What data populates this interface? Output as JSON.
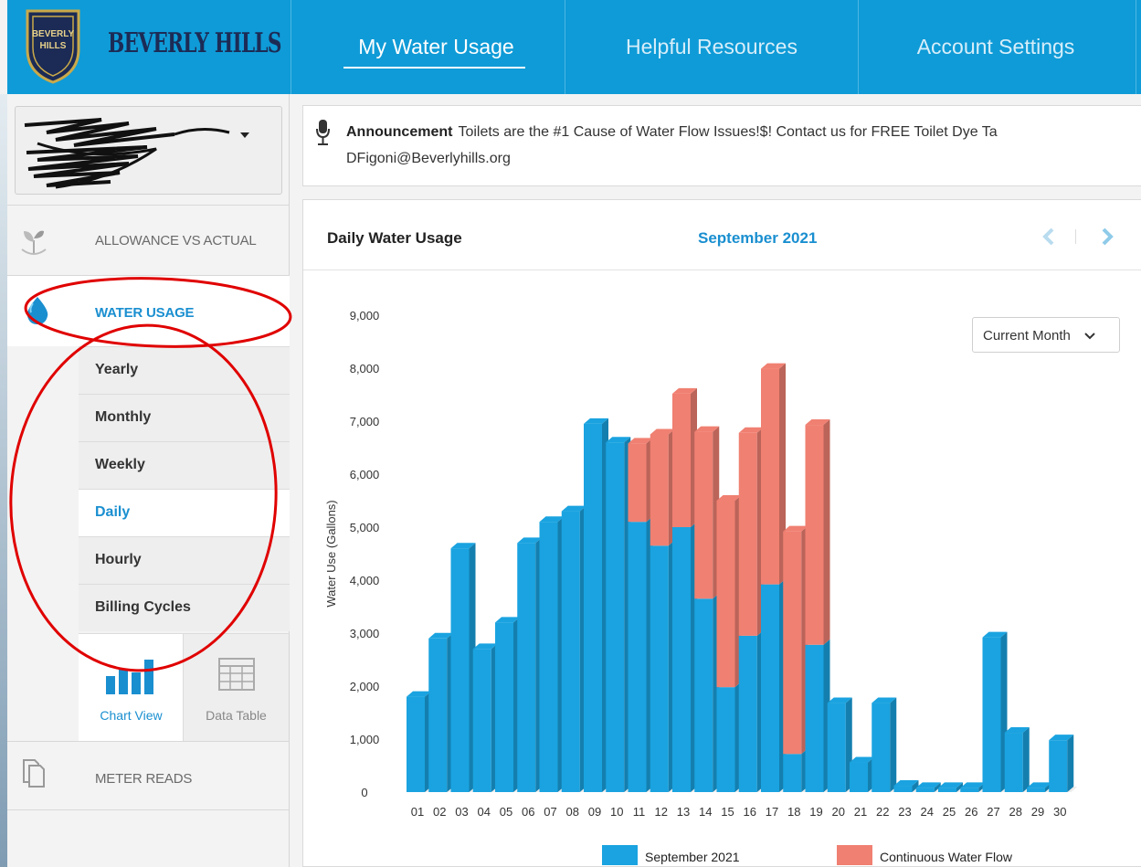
{
  "header": {
    "logo_text": "BEVERLY HILLS",
    "badge_text_line1": "BEVERLY",
    "badge_text_line2": "HILLS",
    "nav": [
      {
        "label": "My Water Usage",
        "active": true
      },
      {
        "label": "Helpful Resources",
        "active": false
      },
      {
        "label": "Account Settings",
        "active": false
      }
    ]
  },
  "sidebar": {
    "items": [
      {
        "label": "ALLOWANCE VS ACTUAL",
        "icon": "plant-icon"
      },
      {
        "label": "WATER USAGE",
        "icon": "water-drop-icon"
      },
      {
        "label": "METER READS",
        "icon": "documents-icon"
      }
    ],
    "subitems": [
      {
        "label": "Yearly",
        "active": false
      },
      {
        "label": "Monthly",
        "active": false
      },
      {
        "label": "Weekly",
        "active": false
      },
      {
        "label": "Daily",
        "active": true
      },
      {
        "label": "Hourly",
        "active": false
      },
      {
        "label": "Billing Cycles",
        "active": false
      }
    ],
    "views": [
      {
        "label": "Chart View",
        "active": true,
        "icon": "bar-chart-icon"
      },
      {
        "label": "Data Table",
        "active": false,
        "icon": "table-grid-icon"
      }
    ]
  },
  "announcement": {
    "title": "Announcement",
    "text": "Toilets are the #1 Cause of Water Flow Issues!$! Contact us for FREE Toilet Dye Ta",
    "email": "DFigoni@Beverlyhills.org"
  },
  "chart_panel": {
    "title": "Daily Water Usage",
    "month": "September 2021",
    "dropdown": "Current Month"
  },
  "colors": {
    "brand_blue": "#0f9bd7",
    "active_blue": "#1a8fd0",
    "series_blue": "#1aa3e0",
    "series_red": "#f08072",
    "annotation_red": "#e00000"
  },
  "chart_data": {
    "type": "bar",
    "stacked": true,
    "ylabel": "Water Use (Gallons)",
    "ylim": [
      0,
      9000
    ],
    "yticks": [
      "0",
      "1,000",
      "2,000",
      "3,000",
      "4,000",
      "5,000",
      "6,000",
      "7,000",
      "8,000",
      "9,000"
    ],
    "categories": [
      "01",
      "02",
      "03",
      "04",
      "05",
      "06",
      "07",
      "08",
      "09",
      "10",
      "11",
      "12",
      "13",
      "14",
      "15",
      "16",
      "17",
      "18",
      "19",
      "20",
      "21",
      "22",
      "23",
      "24",
      "25",
      "26",
      "27",
      "28",
      "29",
      "30"
    ],
    "series": [
      {
        "name": "September 2021",
        "color": "#1aa3e0",
        "values": [
          1800,
          2900,
          4600,
          2700,
          3200,
          4700,
          5100,
          5300,
          6950,
          6600,
          5100,
          4650,
          5000,
          3650,
          1980,
          2950,
          3920,
          720,
          2780,
          1680,
          560,
          1680,
          120,
          80,
          80,
          80,
          2920,
          1120,
          80,
          980
        ]
      },
      {
        "name": "Continuous Water Flow",
        "color": "#f08072",
        "values": [
          0,
          0,
          0,
          0,
          0,
          0,
          0,
          0,
          0,
          0,
          1480,
          2100,
          2520,
          3150,
          3520,
          3830,
          4070,
          4200,
          4150,
          0,
          0,
          0,
          0,
          0,
          0,
          0,
          0,
          0,
          0,
          0
        ]
      }
    ],
    "legend_position": "bottom"
  }
}
